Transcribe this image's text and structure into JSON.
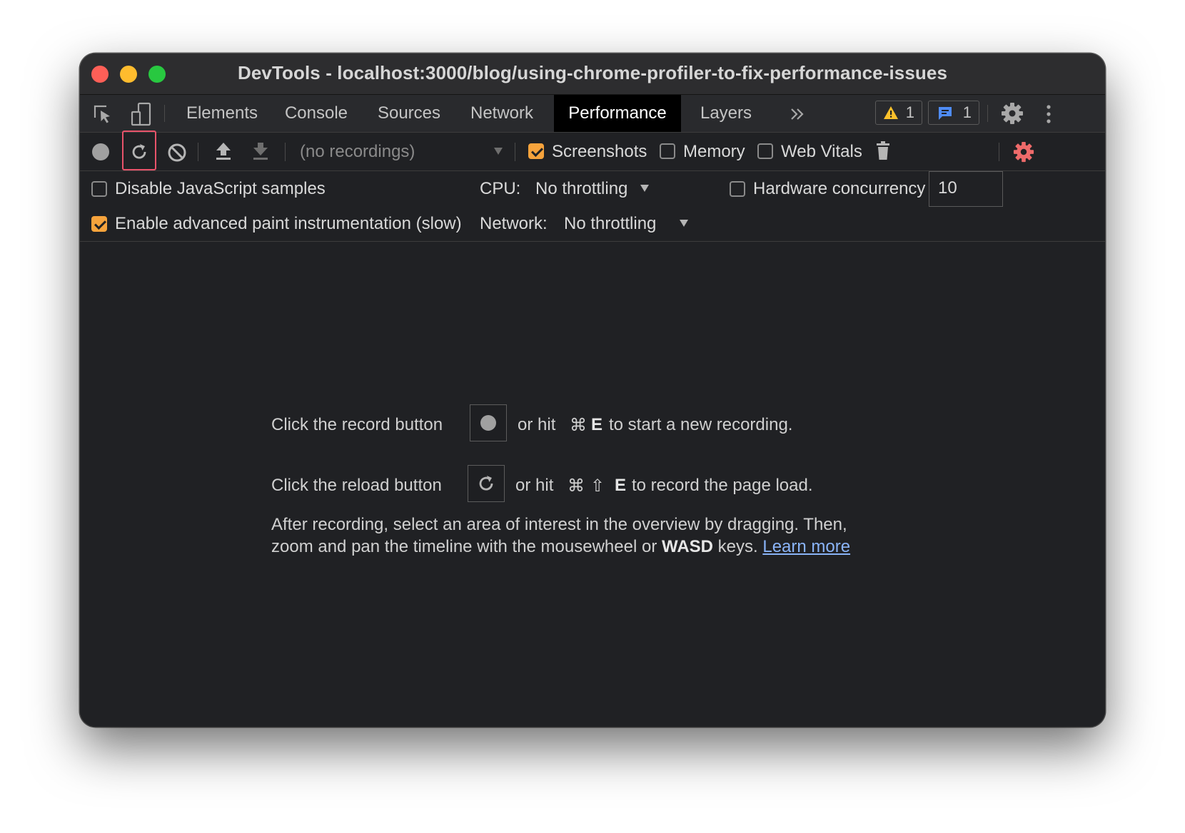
{
  "window": {
    "title": "DevTools - localhost:3000/blog/using-chrome-profiler-to-fix-performance-issues"
  },
  "tabs": [
    {
      "label": "Elements",
      "active": false
    },
    {
      "label": "Console",
      "active": false
    },
    {
      "label": "Sources",
      "active": false
    },
    {
      "label": "Network",
      "active": false
    },
    {
      "label": "Performance",
      "active": true
    },
    {
      "label": "Layers",
      "active": false
    }
  ],
  "tabbar": {
    "more_tabs_icon": "double-chevron-right-icon",
    "warnings_count": "1",
    "messages_count": "1"
  },
  "toolbar": {
    "recordings_select": "(no recordings)",
    "screenshots_label": "Screenshots",
    "screenshots_checked": true,
    "memory_label": "Memory",
    "memory_checked": false,
    "web_vitals_label": "Web Vitals",
    "web_vitals_checked": false
  },
  "settings": {
    "disable_js_samples_label": "Disable JavaScript samples",
    "disable_js_samples_checked": false,
    "advanced_paint_label": "Enable advanced paint instrumentation (slow)",
    "advanced_paint_checked": true,
    "cpu_label": "CPU:",
    "cpu_value": "No throttling",
    "network_label": "Network:",
    "network_value": "No throttling",
    "hardware_concurrency_label": "Hardware concurrency",
    "hardware_concurrency_value": "10",
    "hardware_concurrency_checked": false
  },
  "landing": {
    "record_prefix": "Click the record button",
    "record_hint_or": "or hit",
    "record_shortcut_cmd": "⌘",
    "record_shortcut_key": "E",
    "record_suffix": "to start a new recording.",
    "reload_prefix": "Click the reload button",
    "reload_hint_or": "or hit",
    "reload_shortcut_cmd": "⌘",
    "reload_shortcut_shift": "⇧",
    "reload_shortcut_key": "E",
    "reload_suffix": "to record the page load.",
    "info_line1": "After recording, select an area of interest in the overview by dragging. Then,",
    "info_line2_prefix": "zoom and pan the timeline with the mousewheel or",
    "info_line2_bold": "WASD",
    "info_line2_keys": "keys.",
    "learn_more": "Learn more"
  },
  "colors": {
    "accent_checkbox": "#f6a33c",
    "highlight_box": "#e8536a",
    "settings_gear_active": "#ee6a6a",
    "link": "#8ab4f8",
    "background": "#202124"
  }
}
